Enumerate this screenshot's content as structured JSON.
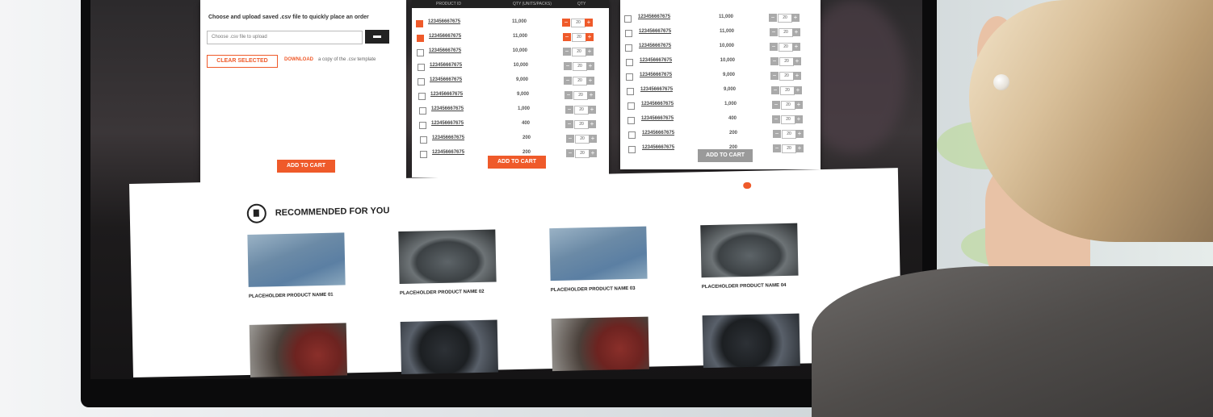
{
  "upload": {
    "instruction": "Choose and upload saved .csv file to quickly place an order",
    "file_placeholder": "Choose .csv file to upload",
    "clear_selected": "CLEAR SELECTED",
    "download_link": "DOWNLOAD",
    "download_rest": "a copy of the .csv template",
    "add_to_cart": "ADD TO CART"
  },
  "table_center": {
    "headers": [
      "PRODUCT ID",
      "QTY (UNITS/PACKS)",
      "QTY"
    ],
    "add_to_cart": "ADD TO CART",
    "rows": [
      {
        "checked": true,
        "id": "123456667675",
        "qty": "11,000",
        "step": "20"
      },
      {
        "checked": true,
        "id": "123456667675",
        "qty": "11,000",
        "step": "20"
      },
      {
        "checked": false,
        "id": "123456667675",
        "qty": "10,000",
        "step": "20"
      },
      {
        "checked": false,
        "id": "123456667675",
        "qty": "10,000",
        "step": "20"
      },
      {
        "checked": false,
        "id": "123456667675",
        "qty": "9,000",
        "step": "20"
      },
      {
        "checked": false,
        "id": "123456667675",
        "qty": "9,000",
        "step": "20"
      },
      {
        "checked": false,
        "id": "123456667675",
        "qty": "1,000",
        "step": "20"
      },
      {
        "checked": false,
        "id": "123456667675",
        "qty": "400",
        "step": "20"
      },
      {
        "checked": false,
        "id": "123456667675",
        "qty": "200",
        "step": "20"
      },
      {
        "checked": false,
        "id": "123456667675",
        "qty": "200",
        "step": "20"
      }
    ]
  },
  "table_right": {
    "add_to_cart": "ADD TO CART",
    "rows": [
      {
        "checked": false,
        "id": "123456667675",
        "qty": "11,000",
        "step": "20"
      },
      {
        "checked": false,
        "id": "123456667675",
        "qty": "11,000",
        "step": "20"
      },
      {
        "checked": false,
        "id": "123456667675",
        "qty": "10,000",
        "step": "20"
      },
      {
        "checked": false,
        "id": "123456667675",
        "qty": "10,000",
        "step": "20"
      },
      {
        "checked": false,
        "id": "123456667675",
        "qty": "9,000",
        "step": "20"
      },
      {
        "checked": false,
        "id": "123456667675",
        "qty": "9,000",
        "step": "20"
      },
      {
        "checked": false,
        "id": "123456667675",
        "qty": "1,000",
        "step": "20"
      },
      {
        "checked": false,
        "id": "123456667675",
        "qty": "400",
        "step": "20"
      },
      {
        "checked": false,
        "id": "123456667675",
        "qty": "200",
        "step": "20"
      },
      {
        "checked": false,
        "id": "123456667675",
        "qty": "200",
        "step": "20"
      }
    ]
  },
  "recommended": {
    "title": "RECOMMENDED FOR YOU",
    "products": [
      {
        "name": "PLACEHOLDER PRODUCT NAME 01",
        "image": "blue-abrasive-rolls"
      },
      {
        "name": "PLACEHOLDER PRODUCT NAME 02",
        "image": "grinding-disc"
      },
      {
        "name": "PLACEHOLDER PRODUCT NAME 03",
        "image": "blue-abrasive-rolls"
      },
      {
        "name": "PLACEHOLDER PRODUCT NAME 04",
        "image": "grinding-disc"
      },
      {
        "name": "",
        "image": "surface-conditioning-discs"
      },
      {
        "name": "",
        "image": "cutoff-wheels"
      },
      {
        "name": "",
        "image": "surface-conditioning-discs"
      },
      {
        "name": "",
        "image": "cutoff-wheels"
      }
    ]
  },
  "colors": {
    "accent": "#ef5a2a",
    "dark": "#222222"
  }
}
